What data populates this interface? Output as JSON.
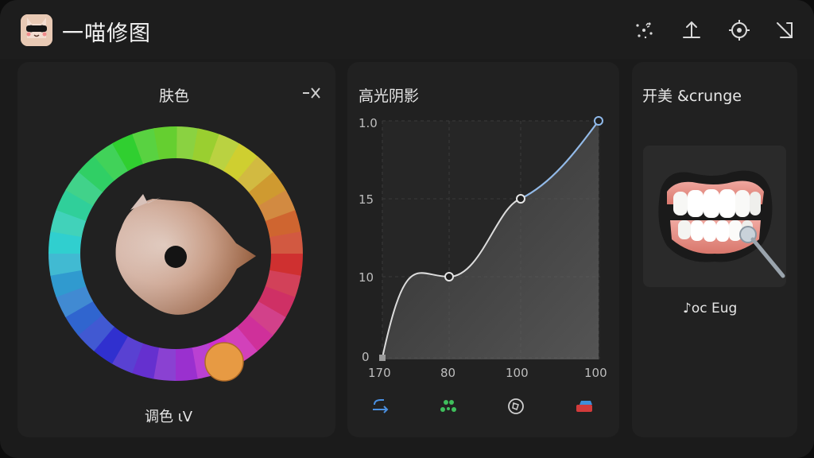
{
  "app": {
    "title": "一喵修图"
  },
  "titlebar": {
    "icons": [
      "sparkle-icon",
      "upload-icon",
      "target-icon",
      "collapse-icon"
    ]
  },
  "skin_panel": {
    "title": "肤色",
    "footer_label": "调色 ιV",
    "accent": "#e79a43"
  },
  "curve_panel": {
    "title": "高光阴影",
    "y_ticks": [
      "1.0",
      "15",
      "10",
      "0"
    ],
    "x_ticks": [
      "170",
      "80",
      "100",
      "100"
    ],
    "mode_icons": [
      "redo-arrow-icon",
      "cluster-icon",
      "aperture-icon",
      "flag-icon"
    ]
  },
  "teeth_panel": {
    "title": "开美 &crunge",
    "caption": "♪oc Eug"
  },
  "chart_data": {
    "type": "line",
    "y_tick_labels": [
      "1.0",
      "15",
      "10",
      "0"
    ],
    "x_tick_labels": [
      "170",
      "80",
      "100",
      "100"
    ],
    "control_points": [
      {
        "x": "170",
        "y": "0"
      },
      {
        "x": "80",
        "y": "10"
      },
      {
        "x": "100",
        "y": "15"
      },
      {
        "x": "100",
        "y": "1.0"
      }
    ],
    "grid": true
  }
}
